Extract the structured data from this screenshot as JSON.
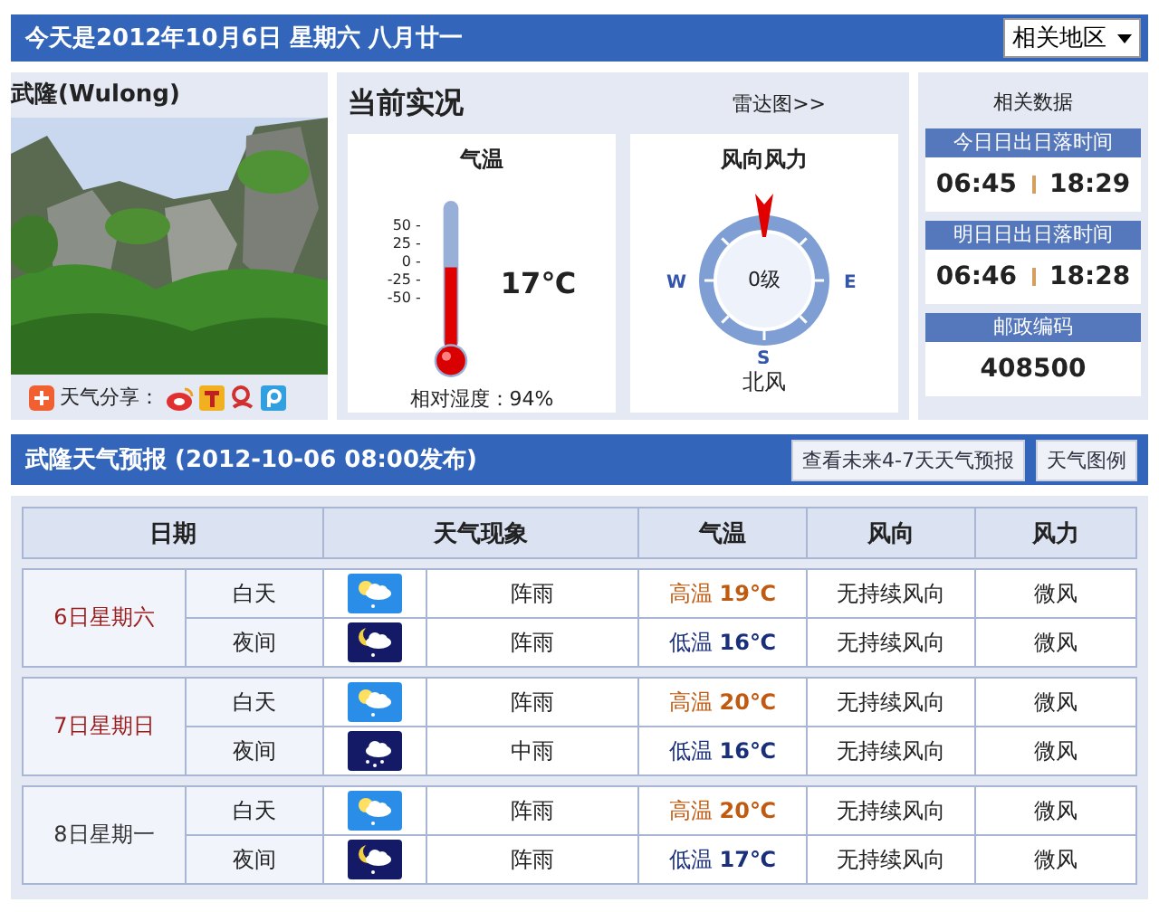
{
  "header": {
    "title": "今天是2012年10月6日 星期六 八月廿一",
    "region_select": "相关地区"
  },
  "city": {
    "name": "武隆(Wulong)",
    "share_label": "天气分享："
  },
  "current": {
    "title": "当前实况",
    "radar_link": "雷达图>>",
    "temperature": {
      "title": "气温",
      "scale": [
        "50 -",
        "25 -",
        "0 -",
        "-25 -",
        "-50 -"
      ],
      "level": 0.55,
      "value": "17℃",
      "humidity": "相对湿度：94%"
    },
    "wind": {
      "title": "风向风力",
      "force": "0级",
      "direction": "北风",
      "compass_labels": [
        "W",
        "E",
        "S"
      ]
    }
  },
  "related": {
    "title": "相关数据",
    "blocks": [
      {
        "label": "今日日出日落时间",
        "kind": "times",
        "values": [
          "06:45",
          "18:29"
        ]
      },
      {
        "label": "明日日出日落时间",
        "kind": "times",
        "values": [
          "06:46",
          "18:28"
        ]
      },
      {
        "label": "邮政编码",
        "kind": "single",
        "values": [
          "408500"
        ]
      }
    ]
  },
  "forecast": {
    "title": "武隆天气预报 (2012-10-06  08:00发布)",
    "buttons": [
      "查看未来4-7天天气预报",
      "天气图例"
    ],
    "columns": [
      "日期",
      "天气现象",
      "气温",
      "风向",
      "风力"
    ],
    "days": [
      {
        "date": "6日星期六",
        "color": "#9b1c1c",
        "periods": [
          {
            "period": {
              "kind": "day",
              "text": "白天"
            },
            "weather": {
              "kind": "shower",
              "text": "阵雨"
            },
            "temp": {
              "kind": "high",
              "label": "高温",
              "value": "19℃"
            },
            "wind_dir": "无持续风向",
            "wind_force": "微风"
          },
          {
            "period": {
              "kind": "night",
              "text": "夜间"
            },
            "weather": {
              "kind": "shower",
              "text": "阵雨"
            },
            "temp": {
              "kind": "low",
              "label": "低温",
              "value": "16℃"
            },
            "wind_dir": "无持续风向",
            "wind_force": "微风"
          }
        ]
      },
      {
        "date": "7日星期日",
        "color": "#9b1c1c",
        "periods": [
          {
            "period": {
              "kind": "day",
              "text": "白天"
            },
            "weather": {
              "kind": "shower",
              "text": "阵雨"
            },
            "temp": {
              "kind": "high",
              "label": "高温",
              "value": "20℃"
            },
            "wind_dir": "无持续风向",
            "wind_force": "微风"
          },
          {
            "period": {
              "kind": "night",
              "text": "夜间"
            },
            "weather": {
              "kind": "rain",
              "text": "中雨"
            },
            "temp": {
              "kind": "low",
              "label": "低温",
              "value": "16℃"
            },
            "wind_dir": "无持续风向",
            "wind_force": "微风"
          }
        ]
      },
      {
        "date": "8日星期一",
        "color": "#333333",
        "periods": [
          {
            "period": {
              "kind": "day",
              "text": "白天"
            },
            "weather": {
              "kind": "shower",
              "text": "阵雨"
            },
            "temp": {
              "kind": "high",
              "label": "高温",
              "value": "20℃"
            },
            "wind_dir": "无持续风向",
            "wind_force": "微风"
          },
          {
            "period": {
              "kind": "night",
              "text": "夜间"
            },
            "weather": {
              "kind": "shower",
              "text": "阵雨"
            },
            "temp": {
              "kind": "low",
              "label": "低温",
              "value": "17℃"
            },
            "wind_dir": "无持续风向",
            "wind_force": "微风"
          }
        ]
      }
    ]
  }
}
